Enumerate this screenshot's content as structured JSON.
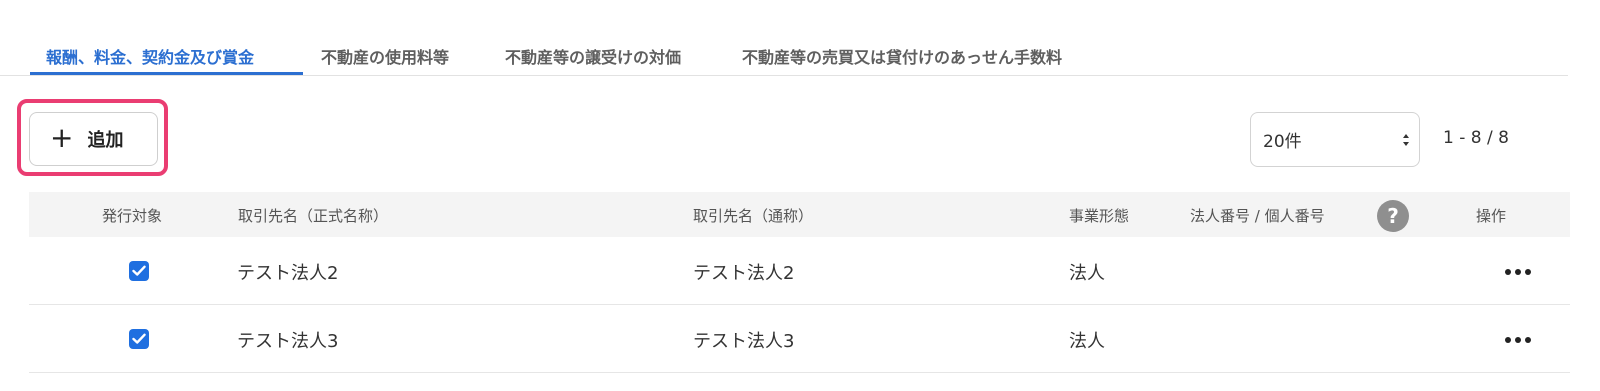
{
  "tabs": [
    {
      "label": "報酬、料金、契約金及び賞金",
      "active": true
    },
    {
      "label": "不動産の使用料等",
      "active": false
    },
    {
      "label": "不動産等の譲受けの対価",
      "active": false
    },
    {
      "label": "不動産等の売買又は貸付けのあっせん手数料",
      "active": false
    }
  ],
  "toolbar": {
    "add_label": "追加",
    "add_icon": "plus-icon",
    "page_size": "20件",
    "pagination": "1 - 8 / 8"
  },
  "table": {
    "headers": {
      "issue": "発行対象",
      "official_name": "取引先名（正式名称）",
      "common_name": "取引先名（通称）",
      "business_type": "事業形態",
      "corporate_number": "法人番号 / 個人番号",
      "actions": "操作"
    },
    "help_icon": "?",
    "rows": [
      {
        "checked": true,
        "official_name": "テスト法人2",
        "common_name": "テスト法人2",
        "business_type": "法人"
      },
      {
        "checked": true,
        "official_name": "テスト法人3",
        "common_name": "テスト法人3",
        "business_type": "法人"
      }
    ]
  },
  "colors": {
    "accent": "#2c6fd1",
    "highlight": "#ea3d72",
    "checkbox": "#1f6fe0"
  }
}
